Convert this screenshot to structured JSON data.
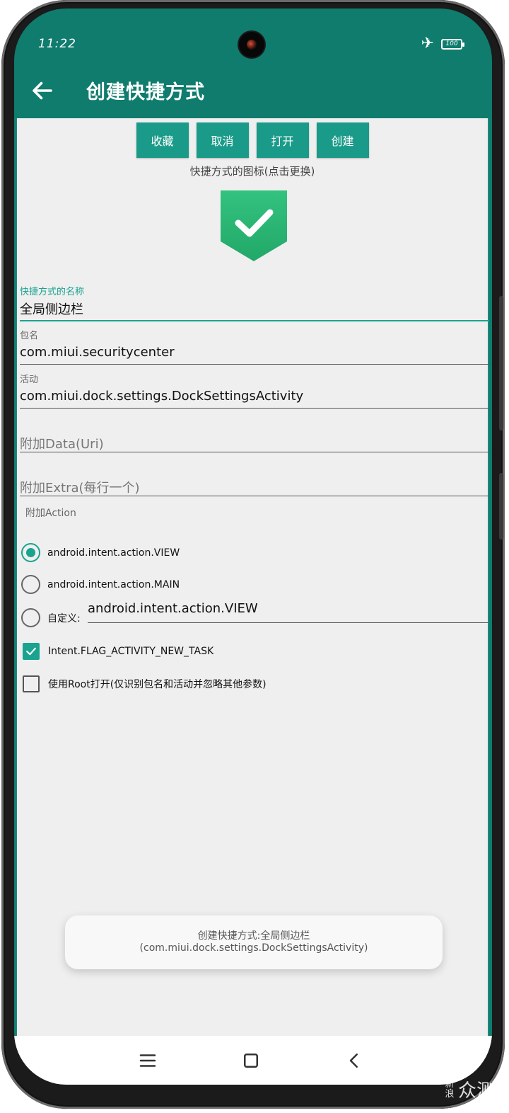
{
  "status_bar": {
    "time": "11:22",
    "battery": "100"
  },
  "app_bar": {
    "title": "创建快捷方式"
  },
  "toolbar": {
    "buttons": [
      "收藏",
      "取消",
      "打开",
      "创建"
    ]
  },
  "icon_section": {
    "caption": "快捷方式的图标(点击更换)",
    "icon": "green-shield-check-icon"
  },
  "fields": {
    "name": {
      "label": "快捷方式的名称",
      "value": "全局侧边栏"
    },
    "package": {
      "label": "包名",
      "value": "com.miui.securitycenter"
    },
    "activity": {
      "label": "活动",
      "value": "com.miui.dock.settings.DockSettingsActivity"
    },
    "data": {
      "placeholder": "附加Data(Uri)"
    },
    "extra": {
      "placeholder": "附加Extra(每行一个)"
    }
  },
  "action": {
    "label": "附加Action",
    "options": [
      {
        "text": "android.intent.action.VIEW",
        "selected": true
      },
      {
        "text": "android.intent.action.MAIN",
        "selected": false
      },
      {
        "text": "自定义:",
        "selected": false
      }
    ],
    "custom_value": "android.intent.action.VIEW"
  },
  "checkboxes": [
    {
      "text": "Intent.FLAG_ACTIVITY_NEW_TASK",
      "checked": true
    },
    {
      "text": "使用Root打开(仅识别包名和活动并忽略其他参数)",
      "checked": false
    }
  ],
  "toast": {
    "line1": "创建快捷方式:全局侧边栏",
    "line2": "(com.miui.dock.settings.DockSettingsActivity)"
  },
  "watermark": {
    "small": "新浪",
    "big": "众测"
  },
  "colors": {
    "primary": "#0f7c6e",
    "accent": "#1aa38f",
    "button": "#1a9b89",
    "background": "#efefef"
  }
}
